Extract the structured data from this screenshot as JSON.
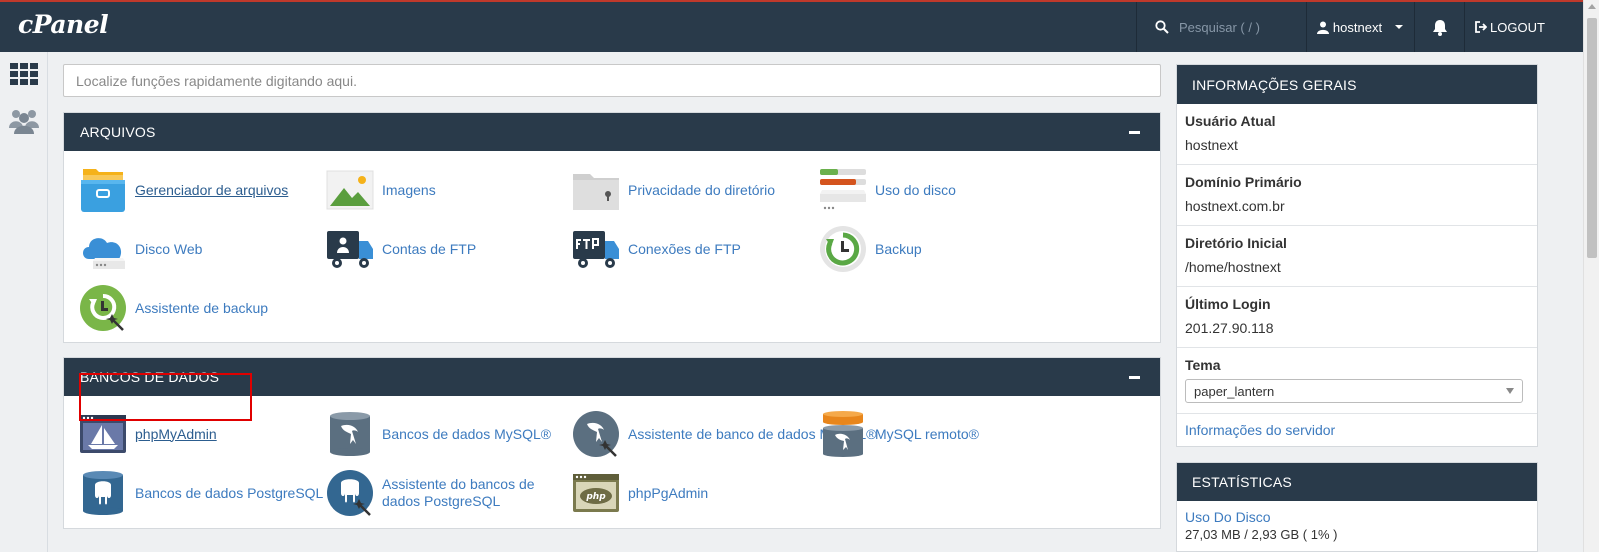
{
  "header": {
    "logo": "cPanel",
    "search_placeholder": "Pesquisar ( / )",
    "username": "hostnext",
    "logout_label": "LOGOUT"
  },
  "quick_search": {
    "placeholder": "Localize funções rapidamente digitando aqui."
  },
  "arquivos": {
    "title": "ARQUIVOS",
    "items": [
      {
        "label": "Gerenciador de arquivos",
        "icon": "file-manager-icon"
      },
      {
        "label": "Imagens",
        "icon": "images-icon"
      },
      {
        "label": "Privacidade do diretório",
        "icon": "directory-privacy-icon"
      },
      {
        "label": "Uso do disco",
        "icon": "disk-usage-icon"
      },
      {
        "label": "Disco Web",
        "icon": "web-disk-icon"
      },
      {
        "label": "Contas de FTP",
        "icon": "ftp-accounts-icon"
      },
      {
        "label": "Conexões de FTP",
        "icon": "ftp-connections-icon"
      },
      {
        "label": "Backup",
        "icon": "backup-icon"
      },
      {
        "label": "Assistente de backup",
        "icon": "backup-wizard-icon"
      }
    ]
  },
  "bancos": {
    "title": "BANCOS DE DADOS",
    "items": [
      {
        "label": "phpMyAdmin",
        "icon": "phpmyadmin-icon"
      },
      {
        "label": "Bancos de dados MySQL®",
        "icon": "mysql-databases-icon"
      },
      {
        "label": "Assistente de banco de dados MySQL®",
        "icon": "mysql-wizard-icon"
      },
      {
        "label": "MySQL remoto®",
        "icon": "remote-mysql-icon"
      },
      {
        "label": "Bancos de dados PostgreSQL",
        "icon": "postgresql-databases-icon"
      },
      {
        "label": "Assistente do bancos de dados PostgreSQL",
        "icon": "postgresql-wizard-icon"
      },
      {
        "label": "phpPgAdmin",
        "icon": "phppgadmin-icon"
      }
    ]
  },
  "info": {
    "title": "INFORMAÇÕES GERAIS",
    "rows": [
      {
        "label": "Usuário Atual",
        "value": "hostnext"
      },
      {
        "label": "Domínio Primário",
        "value": "hostnext.com.br"
      },
      {
        "label": "Diretório Inicial",
        "value": "/home/hostnext"
      },
      {
        "label": "Último Login",
        "value": "201.27.90.118"
      }
    ],
    "theme_label": "Tema",
    "theme_value": "paper_lantern",
    "server_link": "Informações do servidor"
  },
  "stats": {
    "title": "ESTATÍSTICAS",
    "disk_label": "Uso Do Disco",
    "disk_value": "27,03 MB / 2,93 GB ( 1% )"
  },
  "colors": {
    "header": "#293a4a",
    "link": "#3d7bbf",
    "highlight": "#e00000"
  }
}
